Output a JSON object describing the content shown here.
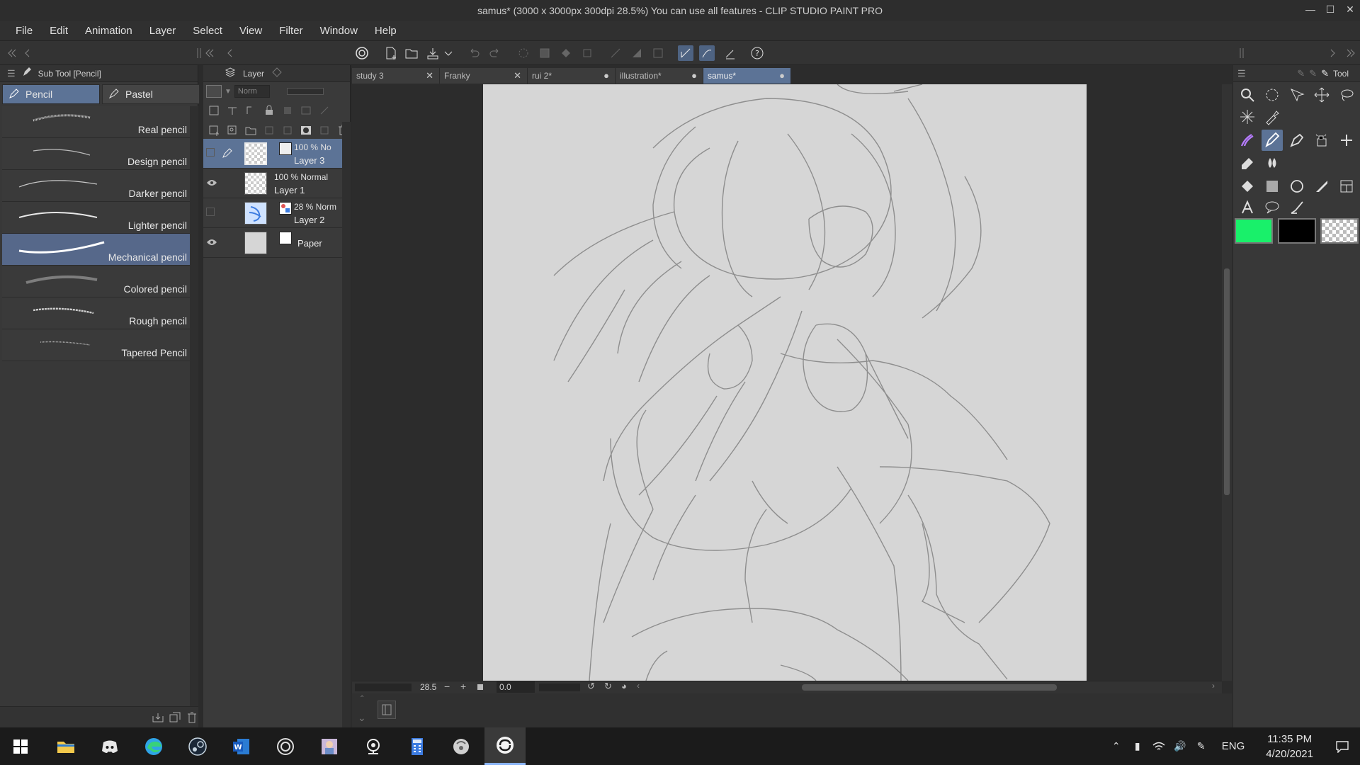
{
  "window": {
    "title": "samus* (3000 x 3000px 300dpi 28.5%)  You can use all features - CLIP STUDIO PAINT PRO",
    "controls": [
      "minimize-icon",
      "maximize-icon",
      "close-icon"
    ]
  },
  "menu": [
    "File",
    "Edit",
    "Animation",
    "Layer",
    "Select",
    "View",
    "Filter",
    "Window",
    "Help"
  ],
  "subtool_panel": {
    "title": "Sub Tool [Pencil]",
    "tabs": [
      {
        "label": "Pencil",
        "active": true
      },
      {
        "label": "Pastel",
        "active": false
      }
    ],
    "brushes": [
      {
        "label": "Real pencil",
        "active": false
      },
      {
        "label": "Design pencil",
        "active": false
      },
      {
        "label": "Darker pencil",
        "active": false
      },
      {
        "label": "Lighter pencil",
        "active": false
      },
      {
        "label": "Mechanical pencil",
        "active": true
      },
      {
        "label": "Colored pencil",
        "active": false
      },
      {
        "label": "Rough pencil",
        "active": false
      },
      {
        "label": "Tapered Pencil",
        "active": false
      }
    ]
  },
  "layer_panel": {
    "title": "Layer",
    "blend_mode": "Norm",
    "layers": [
      {
        "mode": "100 % No",
        "name": "Layer 3",
        "visible": false,
        "active": true,
        "thumb": "transparent"
      },
      {
        "mode": "100 % Normal",
        "name": "Layer 1",
        "visible": true,
        "active": false,
        "thumb": "transparent"
      },
      {
        "mode": "28 % Norm",
        "name": "Layer 2",
        "visible": false,
        "active": false,
        "thumb": "blue-sketch"
      },
      {
        "mode": "",
        "name": "Paper",
        "visible": true,
        "active": false,
        "thumb": "paper"
      }
    ]
  },
  "doc_tabs": [
    {
      "label": "study 3",
      "state": "close",
      "active": false
    },
    {
      "label": "Franky",
      "state": "close",
      "active": false
    },
    {
      "label": "rui 2*",
      "state": "modified",
      "active": false
    },
    {
      "label": "illustration*",
      "state": "modified",
      "active": false
    },
    {
      "label": "samus*",
      "state": "modified",
      "active": true
    }
  ],
  "navigator": {
    "zoom": "28.5",
    "angle": "0.0"
  },
  "tool_panel": {
    "title": "Tool",
    "colors": {
      "main": "#19f06a",
      "sub": "#000000",
      "transparent": "transparent"
    }
  },
  "taskbar": {
    "apps": [
      "windows-start-icon",
      "file-explorer-icon",
      "discord-icon",
      "edge-icon",
      "steam-icon",
      "word-icon",
      "clip-studio-icon",
      "image-viewer-icon",
      "webcam-app-icon",
      "calculator-icon",
      "disc-app-icon",
      "clip-studio-paint-icon"
    ],
    "language": "ENG",
    "time": "11:35 PM",
    "date": "4/20/2021"
  }
}
